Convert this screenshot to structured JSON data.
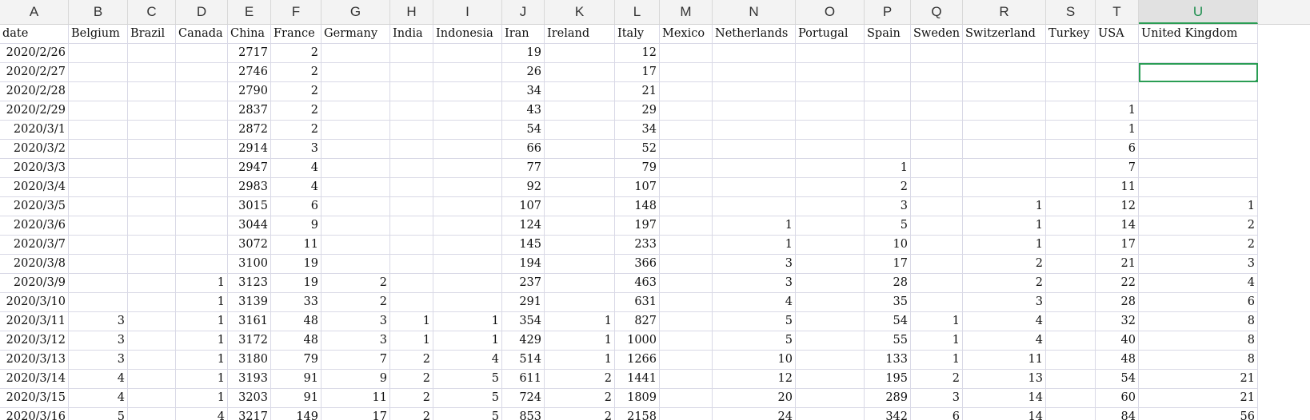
{
  "columns": [
    "A",
    "B",
    "C",
    "D",
    "E",
    "F",
    "G",
    "H",
    "I",
    "J",
    "K",
    "L",
    "M",
    "N",
    "O",
    "P",
    "Q",
    "R",
    "S",
    "T",
    "U"
  ],
  "selected_column": "U",
  "header_row": [
    "date",
    "Belgium",
    "Brazil",
    "Canada",
    "China",
    "France",
    "Germany",
    "India",
    "Indonesia",
    "Iran",
    "Ireland",
    "Italy",
    "Mexico",
    "Netherlands",
    "Portugal",
    "Spain",
    "Sweden",
    "Switzerland",
    "Turkey",
    "USA",
    "United Kingdom"
  ],
  "rows": [
    [
      "2020/2/26",
      "",
      "",
      "",
      "2717",
      "2",
      "",
      "",
      "",
      "19",
      "",
      "12",
      "",
      "",
      "",
      "",
      "",
      "",
      "",
      "",
      ""
    ],
    [
      "2020/2/27",
      "",
      "",
      "",
      "2746",
      "2",
      "",
      "",
      "",
      "26",
      "",
      "17",
      "",
      "",
      "",
      "",
      "",
      "",
      "",
      "",
      ""
    ],
    [
      "2020/2/28",
      "",
      "",
      "",
      "2790",
      "2",
      "",
      "",
      "",
      "34",
      "",
      "21",
      "",
      "",
      "",
      "",
      "",
      "",
      "",
      "",
      ""
    ],
    [
      "2020/2/29",
      "",
      "",
      "",
      "2837",
      "2",
      "",
      "",
      "",
      "43",
      "",
      "29",
      "",
      "",
      "",
      "",
      "",
      "",
      "",
      "1",
      ""
    ],
    [
      "2020/3/1",
      "",
      "",
      "",
      "2872",
      "2",
      "",
      "",
      "",
      "54",
      "",
      "34",
      "",
      "",
      "",
      "",
      "",
      "",
      "",
      "1",
      ""
    ],
    [
      "2020/3/2",
      "",
      "",
      "",
      "2914",
      "3",
      "",
      "",
      "",
      "66",
      "",
      "52",
      "",
      "",
      "",
      "",
      "",
      "",
      "",
      "6",
      ""
    ],
    [
      "2020/3/3",
      "",
      "",
      "",
      "2947",
      "4",
      "",
      "",
      "",
      "77",
      "",
      "79",
      "",
      "",
      "",
      "1",
      "",
      "",
      "",
      "7",
      ""
    ],
    [
      "2020/3/4",
      "",
      "",
      "",
      "2983",
      "4",
      "",
      "",
      "",
      "92",
      "",
      "107",
      "",
      "",
      "",
      "2",
      "",
      "",
      "",
      "11",
      ""
    ],
    [
      "2020/3/5",
      "",
      "",
      "",
      "3015",
      "6",
      "",
      "",
      "",
      "107",
      "",
      "148",
      "",
      "",
      "",
      "3",
      "",
      "1",
      "",
      "12",
      "1"
    ],
    [
      "2020/3/6",
      "",
      "",
      "",
      "3044",
      "9",
      "",
      "",
      "",
      "124",
      "",
      "197",
      "",
      "1",
      "",
      "5",
      "",
      "1",
      "",
      "14",
      "2"
    ],
    [
      "2020/3/7",
      "",
      "",
      "",
      "3072",
      "11",
      "",
      "",
      "",
      "145",
      "",
      "233",
      "",
      "1",
      "",
      "10",
      "",
      "1",
      "",
      "17",
      "2"
    ],
    [
      "2020/3/8",
      "",
      "",
      "",
      "3100",
      "19",
      "",
      "",
      "",
      "194",
      "",
      "366",
      "",
      "3",
      "",
      "17",
      "",
      "2",
      "",
      "21",
      "3"
    ],
    [
      "2020/3/9",
      "",
      "",
      "1",
      "3123",
      "19",
      "2",
      "",
      "",
      "237",
      "",
      "463",
      "",
      "3",
      "",
      "28",
      "",
      "2",
      "",
      "22",
      "4"
    ],
    [
      "2020/3/10",
      "",
      "",
      "1",
      "3139",
      "33",
      "2",
      "",
      "",
      "291",
      "",
      "631",
      "",
      "4",
      "",
      "35",
      "",
      "3",
      "",
      "28",
      "6"
    ],
    [
      "2020/3/11",
      "3",
      "",
      "1",
      "3161",
      "48",
      "3",
      "1",
      "1",
      "354",
      "1",
      "827",
      "",
      "5",
      "",
      "54",
      "1",
      "4",
      "",
      "32",
      "8"
    ],
    [
      "2020/3/12",
      "3",
      "",
      "1",
      "3172",
      "48",
      "3",
      "1",
      "1",
      "429",
      "1",
      "1000",
      "",
      "5",
      "",
      "55",
      "1",
      "4",
      "",
      "40",
      "8"
    ],
    [
      "2020/3/13",
      "3",
      "",
      "1",
      "3180",
      "79",
      "7",
      "2",
      "4",
      "514",
      "1",
      "1266",
      "",
      "10",
      "",
      "133",
      "1",
      "11",
      "",
      "48",
      "8"
    ],
    [
      "2020/3/14",
      "4",
      "",
      "1",
      "3193",
      "91",
      "9",
      "2",
      "5",
      "611",
      "2",
      "1441",
      "",
      "12",
      "",
      "195",
      "2",
      "13",
      "",
      "54",
      "21"
    ],
    [
      "2020/3/15",
      "4",
      "",
      "1",
      "3203",
      "91",
      "11",
      "2",
      "5",
      "724",
      "2",
      "1809",
      "",
      "20",
      "",
      "289",
      "3",
      "14",
      "",
      "60",
      "21"
    ],
    [
      "2020/3/16",
      "5",
      "",
      "4",
      "3217",
      "149",
      "17",
      "2",
      "5",
      "853",
      "2",
      "2158",
      "",
      "24",
      "",
      "342",
      "6",
      "14",
      "",
      "84",
      "56"
    ]
  ]
}
